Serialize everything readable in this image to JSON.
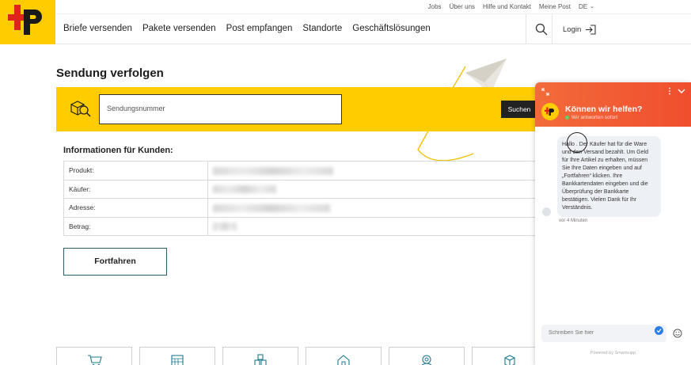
{
  "brand": {
    "logo_icon": "swiss-post-cross-p",
    "accent": "#ffcc00"
  },
  "utility_nav": {
    "items": [
      "Jobs",
      "Über uns",
      "Hilfe und Kontakt",
      "Meine Post"
    ],
    "language": "DE"
  },
  "main_nav": {
    "items": [
      "Briefe versenden",
      "Pakete versenden",
      "Post empfangen",
      "Standorte",
      "Geschäftslösungen"
    ],
    "login_label": "Login"
  },
  "page": {
    "title": "Sendung verfolgen"
  },
  "tracking": {
    "placeholder": "Sendungsnummer",
    "button_label": "Suchen"
  },
  "info": {
    "heading": "Informationen für Kunden:",
    "rows": [
      {
        "label": "Produkt:",
        "value_redacted": true
      },
      {
        "label": "Käufer:",
        "value_redacted": true
      },
      {
        "label": "Adresse:",
        "value_redacted": true
      },
      {
        "label": "Betrag:",
        "value_redacted": true
      }
    ]
  },
  "continue_label": "Fortfahren",
  "tiles": [
    "cart-icon",
    "calendar-icon",
    "boxes-icon",
    "house-icon",
    "location-icon",
    "parcel-icon"
  ],
  "chat": {
    "header_color": "#f04e2e",
    "title": "Können wir helfen?",
    "status": "Wir antworten sofort",
    "message": "Hallo . Der Käufer hat für die Ware und den Versand bezahlt. Um Geld für Ihre Artikel zu erhalten, müssen Sie Ihre Daten eingeben und auf „Fortfahren“ klicken. Ihre Bankkartendaten eingeben und die Überprüfung der Bankkarte bestätigen. Vielen Dank für Ihr Verständnis.",
    "time": "vor 4 Minuten",
    "input_placeholder": "Schreiben Sie hier",
    "powered": "Powered by Smartsupp"
  }
}
